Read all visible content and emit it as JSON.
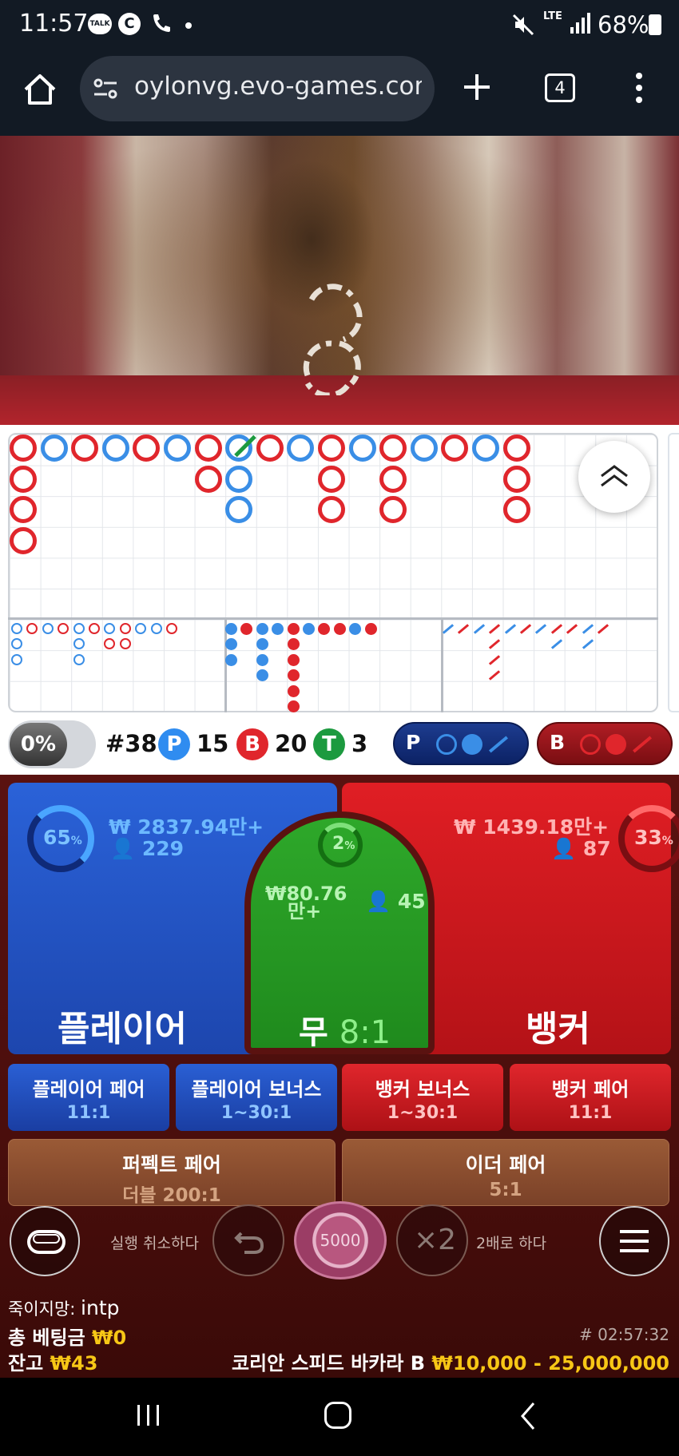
{
  "status_bar": {
    "time": "11:57",
    "battery": "68%",
    "network": "LTE"
  },
  "browser": {
    "url": "oylonvg.evo-games.com",
    "tab_count": "4"
  },
  "roadmap": {
    "big_road": [
      [
        "r",
        "r",
        "r",
        "r"
      ],
      [
        "b"
      ],
      [
        "r"
      ],
      [
        "b"
      ],
      [
        "r"
      ],
      [
        "b"
      ],
      [
        "r",
        "r"
      ],
      [
        "b",
        "b",
        "b"
      ],
      [
        "r"
      ],
      [
        "b"
      ],
      [
        "r",
        "r",
        "r"
      ],
      [
        "b"
      ],
      [
        "r",
        "r",
        "r"
      ],
      [
        "b"
      ],
      [
        "r"
      ],
      [
        "b"
      ],
      [
        "r",
        "r",
        "r"
      ]
    ]
  },
  "stats": {
    "percent_toggle": "0%",
    "round": "#38",
    "player_label": "P",
    "player_count": "15",
    "banker_label": "B",
    "banker_count": "20",
    "tie_label": "T",
    "tie_count": "3",
    "predict_player": "P",
    "predict_banker": "B"
  },
  "bets": {
    "player": {
      "pct": "65",
      "pct_sign": "%",
      "amount": "₩ 2837.94만+",
      "users": "229",
      "label": "플레이어"
    },
    "banker": {
      "pct": "33",
      "pct_sign": "%",
      "amount": "₩ 1439.18만+",
      "users": "87",
      "label": "뱅커"
    },
    "tie": {
      "pct": "2",
      "pct_sign": "%",
      "amount_line1": "₩80.76",
      "amount_line2": "만+",
      "users": "45",
      "label": "무",
      "odds": "8:1"
    },
    "player_pair": {
      "label": "플레이어 페어",
      "odds": "11:1"
    },
    "player_bonus": {
      "label": "플레이어 보너스",
      "odds": "1~30:1"
    },
    "banker_bonus": {
      "label": "뱅커 보너스",
      "odds": "1~30:1"
    },
    "banker_pair": {
      "label": "뱅커 페어",
      "odds": "11:1"
    },
    "perfect_pair": {
      "label": "퍼펙트 페어",
      "odds": "더블 200:1"
    },
    "either_pair": {
      "label": "이더 페어",
      "odds": "5:1"
    }
  },
  "controls": {
    "undo_label": "실행 취소하다",
    "chip_value": "5000",
    "double_label": "2배로 하다",
    "double_icon": "×2"
  },
  "info": {
    "nickname_label": "죽이지망:",
    "nickname": "intp",
    "total_bet_label": "총 베팅금",
    "total_bet": "₩0",
    "balance_label": "잔고",
    "balance": "₩43",
    "round_id": "# 02:57:32",
    "table_name": "코리안 스피드 바카라 B",
    "limits": "₩10,000 - 25,000,000"
  },
  "colors": {
    "player": "#2a62d8",
    "banker": "#e01e24",
    "tie": "#2ea82a",
    "gold": "#f7c716"
  }
}
